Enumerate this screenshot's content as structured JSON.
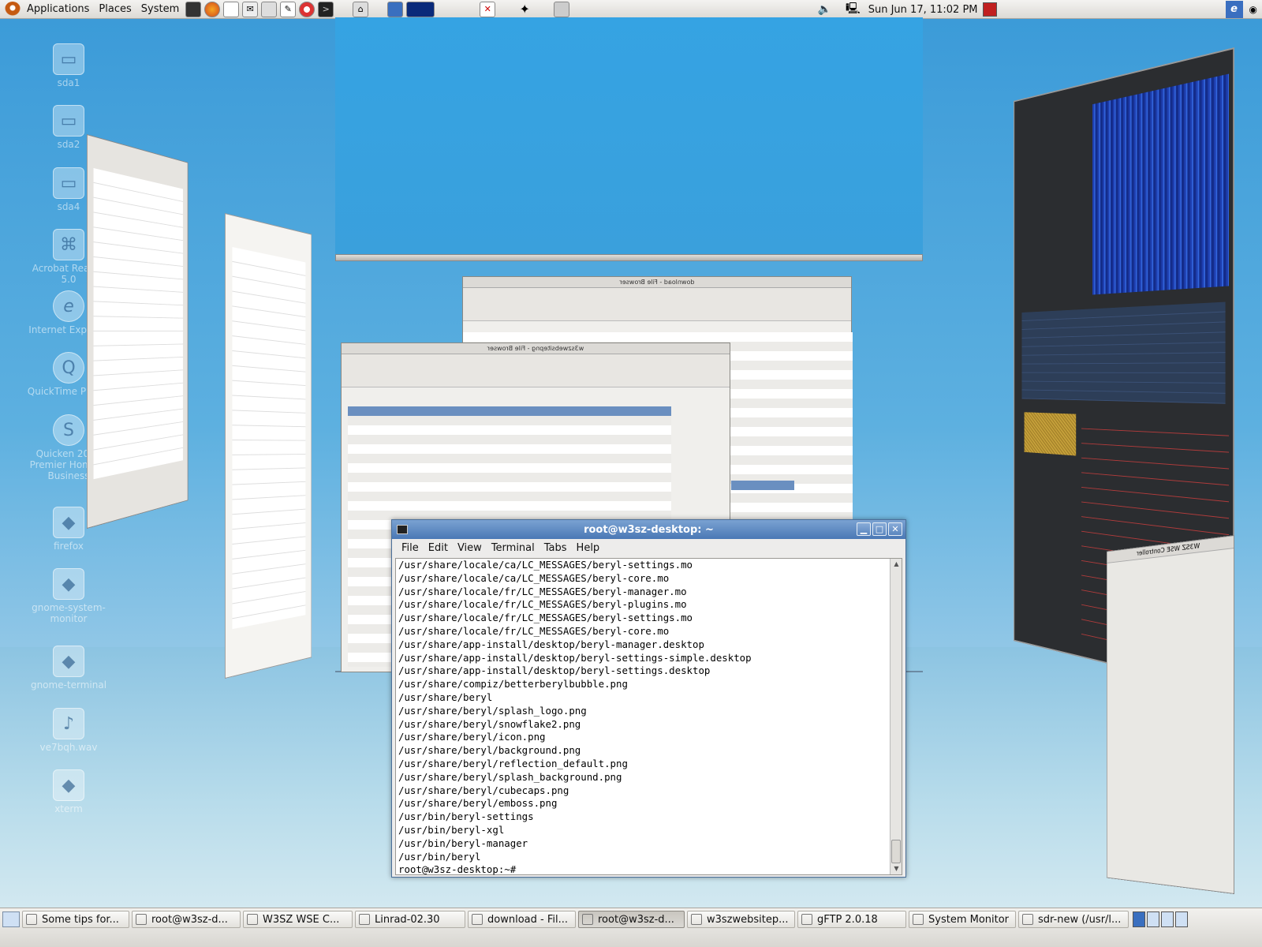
{
  "top_panel": {
    "menus": [
      "Applications",
      "Places",
      "System"
    ],
    "clock": "Sun Jun 17, 11:02 PM"
  },
  "desktop": {
    "icons": [
      {
        "label": "sda1",
        "icon": "drive-icon"
      },
      {
        "label": "sda2",
        "icon": "drive-icon"
      },
      {
        "label": "sda4",
        "icon": "drive-icon"
      },
      {
        "label": "Acrobat Reader 5.0",
        "icon": "acrobat-icon"
      },
      {
        "label": "Internet Explorer",
        "icon": "ie-icon"
      },
      {
        "label": "QuickTime Player",
        "icon": "quicktime-icon"
      },
      {
        "label": "Quicken 2005 Premier Home & Business",
        "icon": "quicken-icon"
      },
      {
        "label": "firefox",
        "icon": "launcher-icon"
      },
      {
        "label": "gnome-system-monitor",
        "icon": "launcher-icon"
      },
      {
        "label": "gnome-terminal",
        "icon": "launcher-icon"
      },
      {
        "label": "ve7bqh.wav",
        "icon": "audio-file-icon"
      },
      {
        "label": "xterm",
        "icon": "launcher-icon"
      }
    ]
  },
  "terminal": {
    "title": "root@w3sz-desktop: ~",
    "menu": [
      "File",
      "Edit",
      "View",
      "Terminal",
      "Tabs",
      "Help"
    ],
    "lines": [
      "/usr/share/locale/ca/LC_MESSAGES/beryl-settings.mo",
      "/usr/share/locale/ca/LC_MESSAGES/beryl-core.mo",
      "/usr/share/locale/fr/LC_MESSAGES/beryl-manager.mo",
      "/usr/share/locale/fr/LC_MESSAGES/beryl-plugins.mo",
      "/usr/share/locale/fr/LC_MESSAGES/beryl-settings.mo",
      "/usr/share/locale/fr/LC_MESSAGES/beryl-core.mo",
      "/usr/share/app-install/desktop/beryl-manager.desktop",
      "/usr/share/app-install/desktop/beryl-settings-simple.desktop",
      "/usr/share/app-install/desktop/beryl-settings.desktop",
      "/usr/share/compiz/betterberylbubble.png",
      "/usr/share/beryl",
      "/usr/share/beryl/splash_logo.png",
      "/usr/share/beryl/snowflake2.png",
      "/usr/share/beryl/icon.png",
      "/usr/share/beryl/background.png",
      "/usr/share/beryl/reflection_default.png",
      "/usr/share/beryl/splash_background.png",
      "/usr/share/beryl/cubecaps.png",
      "/usr/share/beryl/emboss.png",
      "/usr/bin/beryl-settings",
      "/usr/bin/beryl-xgl",
      "/usr/bin/beryl-manager",
      "/usr/bin/beryl",
      "root@w3sz-desktop:~# "
    ]
  },
  "file_browser_back": {
    "title": "download - File Browser"
  },
  "file_browser_front": {
    "title": "w3szwebsitepng - File Browser"
  },
  "control_window": {
    "title": "W3SZ WSE Controller"
  },
  "taskbar": {
    "tasks": [
      {
        "label": "Some tips for...",
        "icon": "firefox-icon",
        "active": false
      },
      {
        "label": "root@w3sz-d...",
        "icon": "terminal-icon",
        "active": false
      },
      {
        "label": "W3SZ WSE C...",
        "icon": "window-icon",
        "active": false
      },
      {
        "label": "Linrad-02.30",
        "icon": "window-icon",
        "active": false
      },
      {
        "label": "download - Fil...",
        "icon": "folder-icon",
        "active": false
      },
      {
        "label": "root@w3sz-d...",
        "icon": "terminal-icon",
        "active": true
      },
      {
        "label": "w3szwebsitep...",
        "icon": "folder-icon",
        "active": false
      },
      {
        "label": "gFTP 2.0.18",
        "icon": "gftp-icon",
        "active": false
      },
      {
        "label": "System Monitor",
        "icon": "monitor-icon",
        "active": false
      },
      {
        "label": "sdr-new (/usr/l...",
        "icon": "editor-icon",
        "active": false
      }
    ]
  }
}
